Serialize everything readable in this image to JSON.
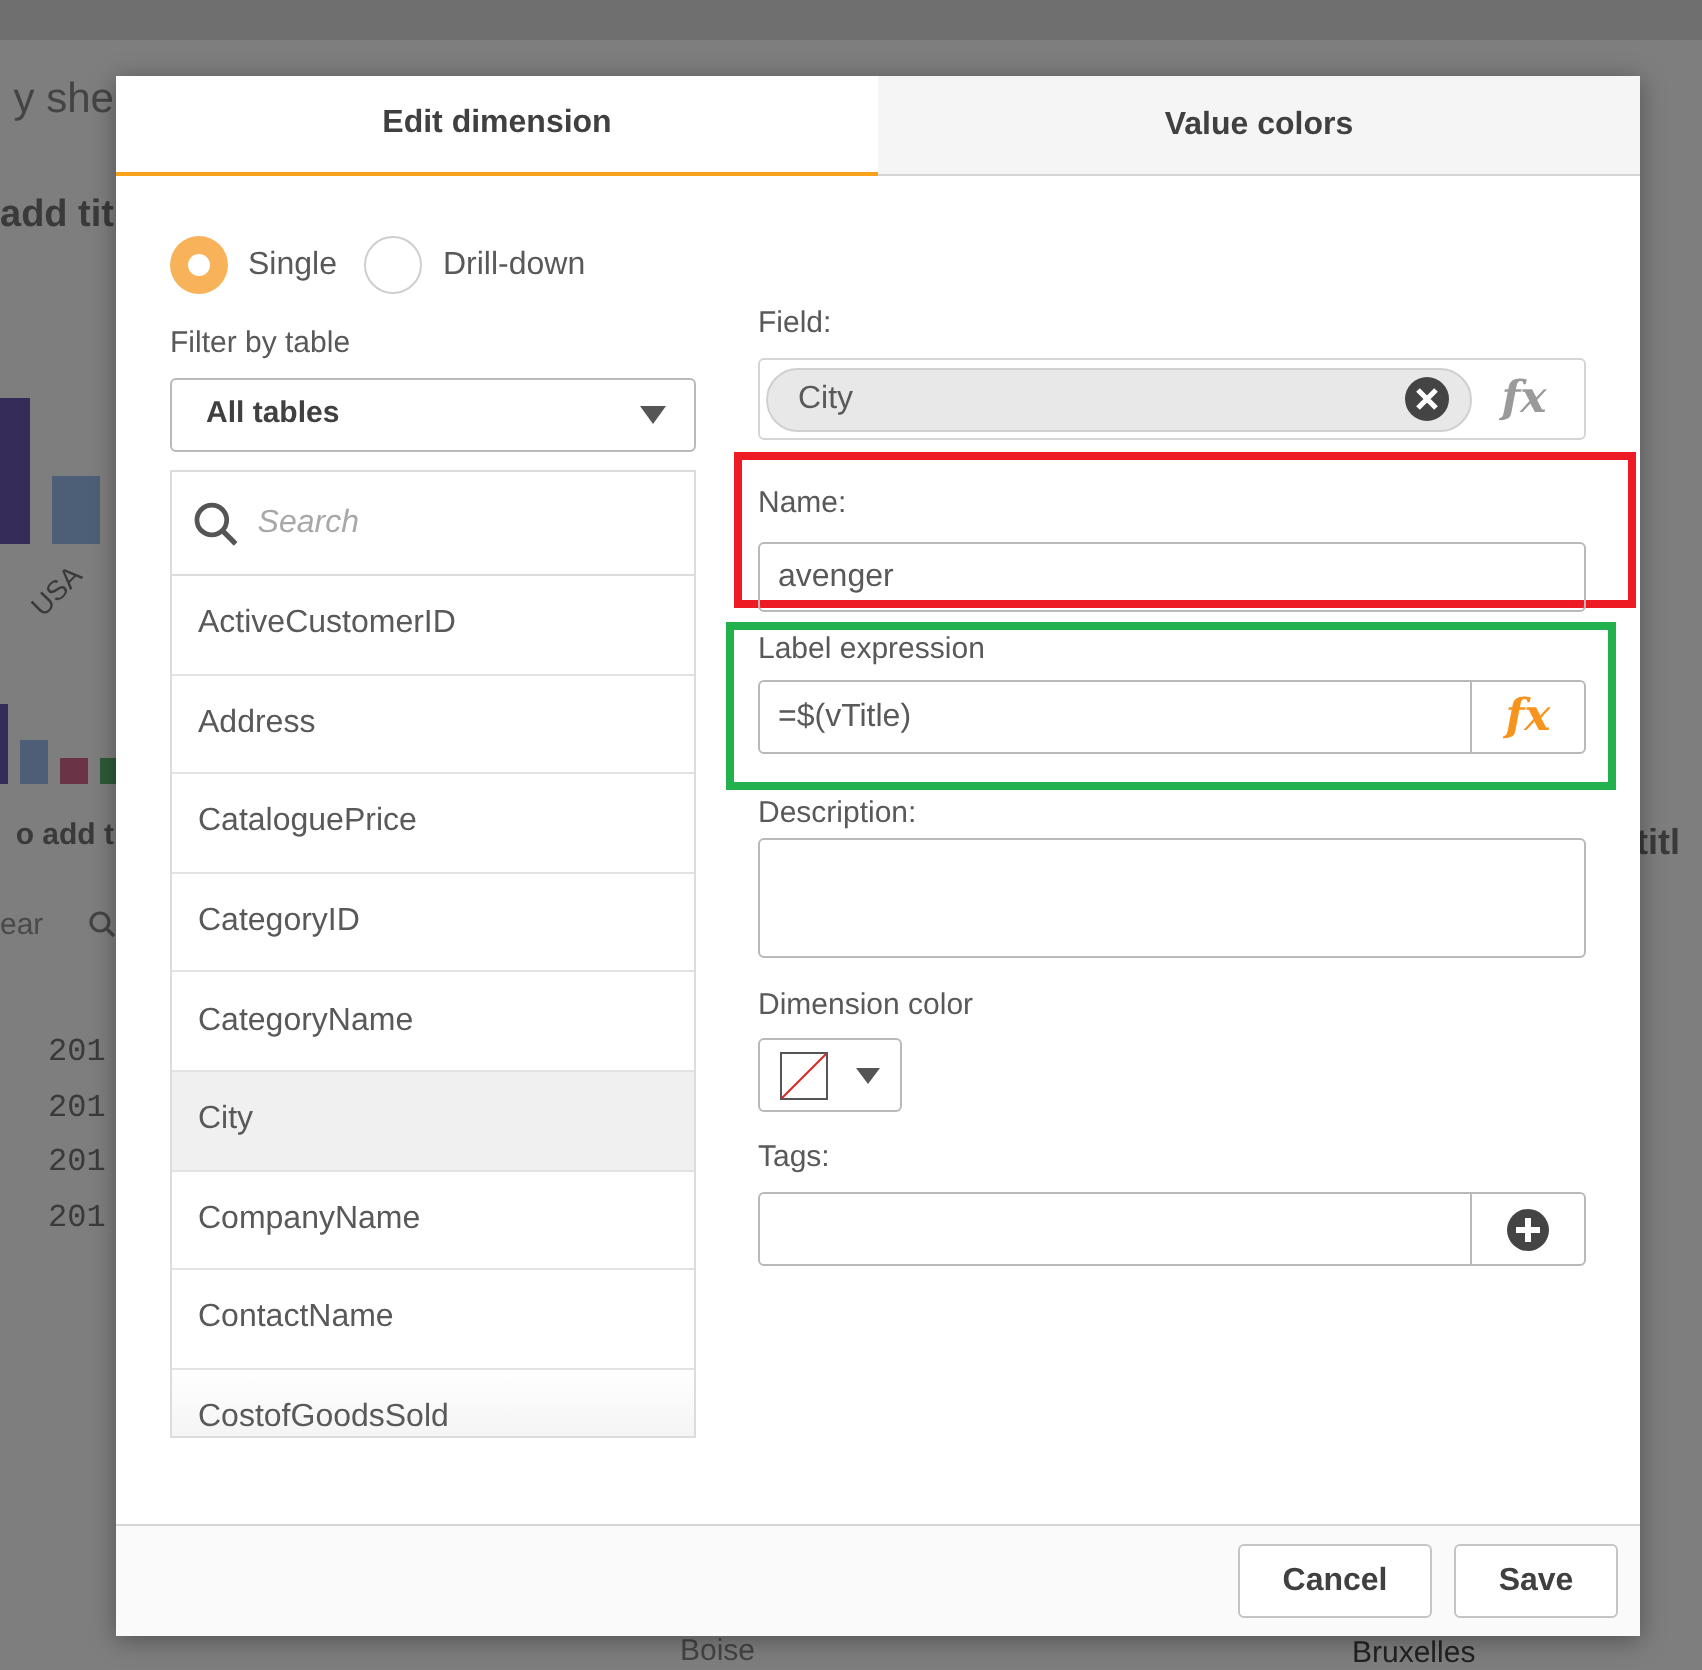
{
  "background": {
    "sheet_title": "y she",
    "chart_titles": [
      "add tit",
      "o add t"
    ],
    "axis_label": "USA",
    "search_hint": "ear",
    "years": [
      "201",
      "201",
      "201",
      "201"
    ],
    "right_title": "titl",
    "map_labels": [
      "Boise",
      "Bruxelles"
    ]
  },
  "annotations": [
    {
      "color": "#ed1c24"
    },
    {
      "color": "#22b14c"
    }
  ],
  "dialog": {
    "tabs": [
      {
        "label": "Edit dimension",
        "selected": true
      },
      {
        "label": "Value colors",
        "selected": false
      }
    ],
    "modes": [
      {
        "label": "Single",
        "selected": true
      },
      {
        "label": "Drill-down",
        "selected": false
      }
    ],
    "filter": {
      "label": "Filter by table",
      "value": "All tables"
    },
    "search": {
      "placeholder": "Search"
    },
    "fields": [
      {
        "label": "ActiveCustomerID",
        "selected": false
      },
      {
        "label": "Address",
        "selected": false
      },
      {
        "label": "CataloguePrice",
        "selected": false
      },
      {
        "label": "CategoryID",
        "selected": false
      },
      {
        "label": "CategoryName",
        "selected": false
      },
      {
        "label": "City",
        "selected": true
      },
      {
        "label": "CompanyName",
        "selected": false
      },
      {
        "label": "ContactName",
        "selected": false
      },
      {
        "label": "CostofGoodsSold",
        "selected": false
      }
    ],
    "field": {
      "label": "Field:",
      "value": "City",
      "function_button": {
        "text": "fx",
        "active": false
      }
    },
    "name": {
      "label": "Name:",
      "value": "avenger"
    },
    "label_expression": {
      "label": "Label expression",
      "value": "=$(vTitle)",
      "function_button": {
        "text": "fx",
        "active": true
      }
    },
    "description": {
      "label": "Description:"
    },
    "dimension_color": {
      "label": "Dimension color"
    },
    "tags": {
      "label": "Tags:"
    },
    "buttons": [
      "Cancel",
      "Save"
    ]
  }
}
